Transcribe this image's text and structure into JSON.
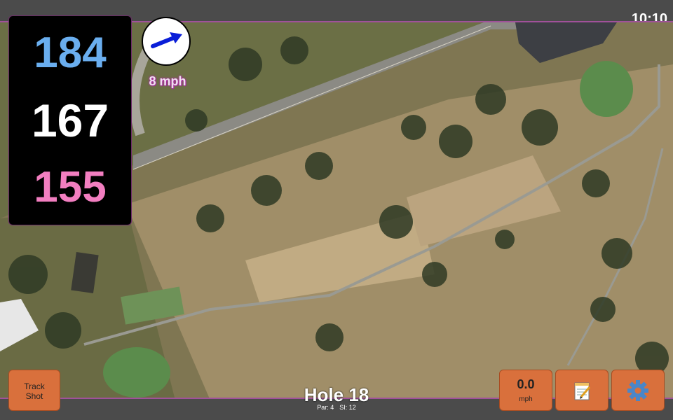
{
  "status": {
    "time": "10:10"
  },
  "distances": {
    "back": "184",
    "middle": "167",
    "front": "155"
  },
  "wind": {
    "speed_label": "8 mph",
    "icon": "wind-arrow-icon"
  },
  "buttons": {
    "track_shot_line1": "Track",
    "track_shot_line2": "Shot",
    "speed_value": "0.0",
    "speed_unit": "mph",
    "notes_icon": "notepad-icon",
    "settings_icon": "gear-icon"
  },
  "hole": {
    "title": "Hole 18",
    "par": "Par: 4",
    "si": "SI: 12"
  },
  "colors": {
    "back_distance": "#6aaeef",
    "middle_distance": "#ffffff",
    "front_distance": "#f27ec0",
    "button_orange": "#d9703c",
    "accent_purple": "#a0519a"
  }
}
